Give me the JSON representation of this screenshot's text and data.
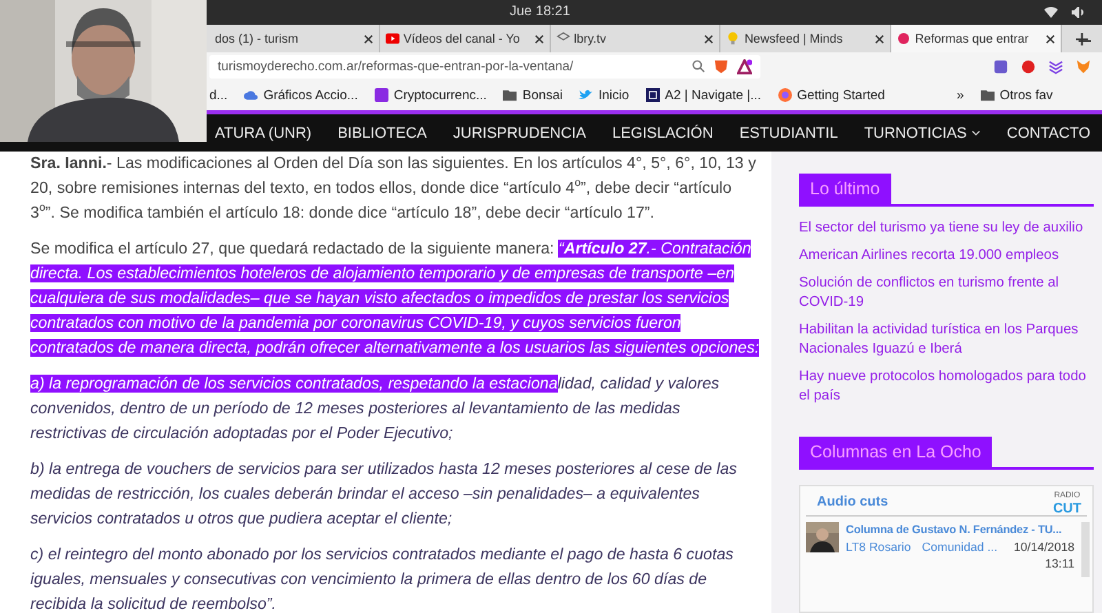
{
  "system_bar": {
    "clock": "Jue 18:21"
  },
  "browser": {
    "tabs": [
      {
        "title": "dos (1) - turism",
        "selected": false
      },
      {
        "title": "Vídeos del canal - Yo",
        "selected": false
      },
      {
        "title": "lbry.tv",
        "selected": false
      },
      {
        "title": "Newsfeed | Minds",
        "selected": false
      },
      {
        "title": "Reformas que entrar",
        "selected": true
      }
    ],
    "url": "turismoyderecho.com.ar/reformas-que-entran-por-la-ventana/",
    "bookmarks": [
      "d...",
      "Gráficos Accio...",
      "Cryptocurrenc...",
      "Bonsai",
      "Inicio",
      "A2 | Navigate |...",
      "Getting Started"
    ],
    "more": "»",
    "other_bookmarks": "Otros fav"
  },
  "site_nav": {
    "items": [
      {
        "label": "ATURA (UNR)",
        "dropdown": false
      },
      {
        "label": "BIBLIOTECA",
        "dropdown": false
      },
      {
        "label": "JURISPRUDENCIA",
        "dropdown": false
      },
      {
        "label": "LEGISLACIÓN",
        "dropdown": false
      },
      {
        "label": "ESTUDIANTIL",
        "dropdown": false
      },
      {
        "label": "TURNOTICIAS",
        "dropdown": true
      },
      {
        "label": "CONTACTO",
        "dropdown": false
      }
    ]
  },
  "article": {
    "paragraphs": [
      {
        "kind": "body",
        "segments": [
          {
            "text": "**Sra. Ianni.**- Las modificaciones al Orden del Día son las siguientes. En los artículos 4°, 5°, 6°, 10, 13 y 20, sobre remisiones internas del texto, en todos ellos, donde dice “artículo 4$^{o}$”, debe decir “artículo 3$^{o}$”. Se modifica también el artículo 18: donde dice “artículo 18”, debe decir “artículo 17”.",
            "highlighted": false
          }
        ]
      },
      {
        "kind": "body",
        "segments": [
          {
            "text": "Se modifica el artículo 27, que quedará redactado de la siguiente manera: ",
            "highlighted": false
          },
          {
            "text": "“**Artículo 27**.- Contratación directa. Los establecimientos hoteleros de alojamiento temporario y de empresas de transporte –en cualquiera de sus modalidades– que se hayan visto afectados o impedidos de prestar los servicios contratados con motivo de la pandemia por coronavirus COVID-19, y cuyos servicios fueron contratados de manera directa, podrán ofrecer alternativamente a los usuarios las siguientes opciones:",
            "highlighted": true
          }
        ]
      },
      {
        "kind": "quote",
        "segments": [
          {
            "text": "a) la reprogramación de los servicios contratados, respetando la estaciona",
            "highlighted": true
          },
          {
            "text": "lidad, calidad y valores convenidos, dentro de un período de 12 meses posteriores al levantamiento de las medidas restrictivas de circulación adoptadas por el Poder Ejecutivo;",
            "highlighted": false
          }
        ]
      },
      {
        "kind": "quote",
        "segments": [
          {
            "text": "b) la entrega de vouchers de servicios para ser utilizados hasta 12 meses posteriores al cese de las medidas de restricción, los cuales deberán brindar el acceso –sin penalidades– a equivalentes servicios contratados u otros que pudiera aceptar el cliente;",
            "highlighted": false
          }
        ]
      },
      {
        "kind": "quote",
        "segments": [
          {
            "text": "c) el reintegro del monto abonado por los servicios contratados mediante el pago de hasta 6 cuotas iguales, mensuales y consecutivas con vencimiento la primera de ellas dentro de los 60 días de recibida la solicitud de reembolso”.",
            "highlighted": false
          }
        ]
      }
    ]
  },
  "sidebar": {
    "latest": {
      "title": "Lo último",
      "links": [
        "El sector del turismo ya tiene su ley de auxilio",
        "American Airlines recorta 19.000 empleos",
        "Solución de conflictos en turismo frente al COVID-19",
        "Habilitan la actividad turística en los Parques Nacionales Iguazú e Iberá",
        "Hay nueve protocolos homologados para todo el país"
      ]
    },
    "columns": {
      "title": "Columnas en La Ocho",
      "widget": {
        "title": "Audio cuts",
        "logo_top": "RADIO",
        "logo_bottom": "CUT",
        "item": {
          "title": "Columna de Gustavo N. Fernández - TU...",
          "station": "LT8 Rosario",
          "category": "Comunidad ...",
          "date": "10/14/2018",
          "time": "13:11"
        }
      }
    }
  }
}
